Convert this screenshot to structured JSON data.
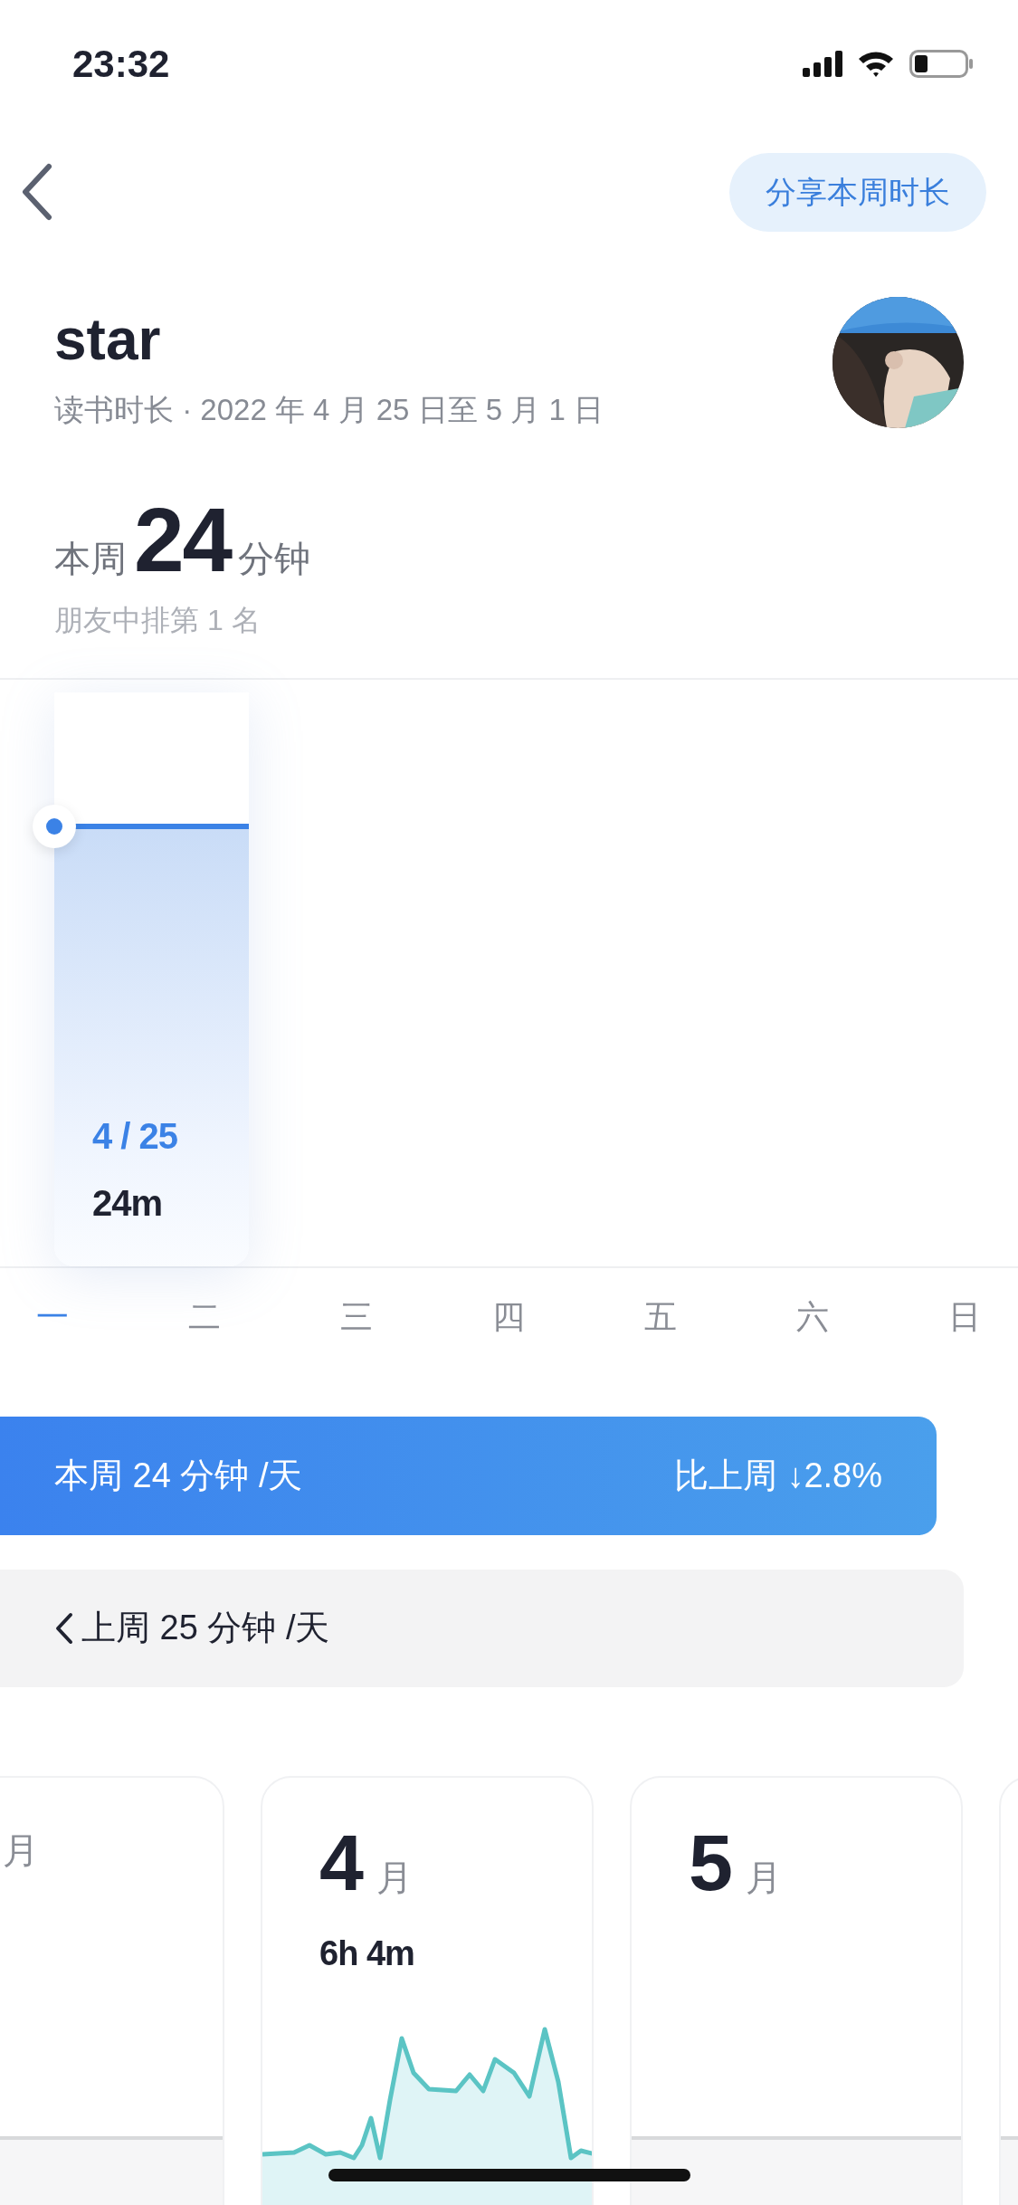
{
  "status_bar": {
    "time": "23:32"
  },
  "header": {
    "share_button": "分享本周时长"
  },
  "profile": {
    "name": "star",
    "subtitle": "读书时长 · 2022 年 4 月 25 日至 5 月 1 日"
  },
  "summary": {
    "prefix": "本周",
    "value": "24",
    "unit": "分钟",
    "rank": "朋友中排第 1 名"
  },
  "week_chart": {
    "highlight": {
      "date": "4 / 25",
      "value": "24m"
    },
    "days": [
      {
        "label": "一",
        "selected": true
      },
      {
        "label": "二",
        "selected": false
      },
      {
        "label": "三",
        "selected": false
      },
      {
        "label": "四",
        "selected": false
      },
      {
        "label": "五",
        "selected": false
      },
      {
        "label": "六",
        "selected": false
      },
      {
        "label": "日",
        "selected": false
      }
    ]
  },
  "this_week_banner": {
    "text": "本周 24 分钟 /天",
    "comparison": "比上周 ↓2.8%"
  },
  "last_week_bar": {
    "text": "上周 25 分钟 /天"
  },
  "month_cards": [
    {
      "kind": "plain",
      "unit": "月"
    },
    {
      "kind": "sparkline",
      "number": "4",
      "unit": "月",
      "total": "6h 4m"
    },
    {
      "kind": "plain",
      "number": "5",
      "unit": "月"
    },
    {
      "kind": "plain"
    }
  ]
}
